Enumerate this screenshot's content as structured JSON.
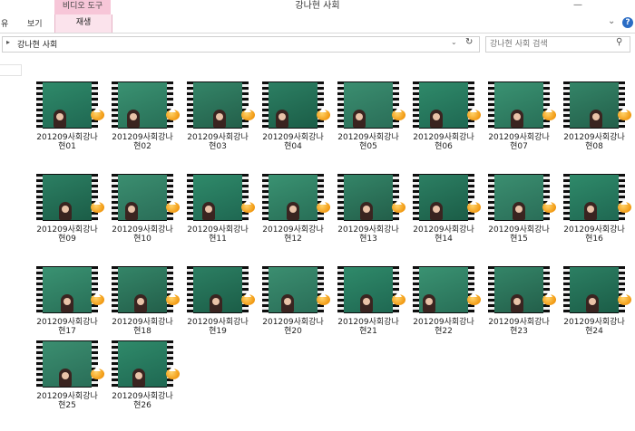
{
  "window": {
    "title": "강나현 사회",
    "contextual_tab_group": "비디오 도구",
    "minimize_glyph": "—"
  },
  "ribbon": {
    "tabs": [
      {
        "label": "유"
      },
      {
        "label": "보기"
      },
      {
        "label": "재생"
      }
    ],
    "expand_glyph": "⌄",
    "help_glyph": "?"
  },
  "address": {
    "breadcrumb": "강나현 사회",
    "search_placeholder": "강나현 사회 검색"
  },
  "files": [
    {
      "line1": "201209사회강나",
      "line2": "현01"
    },
    {
      "line1": "201209사회강나",
      "line2": "현02"
    },
    {
      "line1": "201209사회강나",
      "line2": "현03"
    },
    {
      "line1": "201209사회강나",
      "line2": "현04"
    },
    {
      "line1": "201209사회강나",
      "line2": "현05"
    },
    {
      "line1": "201209사회강나",
      "line2": "현06"
    },
    {
      "line1": "201209사회강나",
      "line2": "현07"
    },
    {
      "line1": "201209사회강나",
      "line2": "현08"
    },
    {
      "line1": "201209사회강나",
      "line2": "현09"
    },
    {
      "line1": "201209사회강나",
      "line2": "현10"
    },
    {
      "line1": "201209사회강나",
      "line2": "현11"
    },
    {
      "line1": "201209사회강나",
      "line2": "현12"
    },
    {
      "line1": "201209사회강나",
      "line2": "현13"
    },
    {
      "line1": "201209사회강나",
      "line2": "현14"
    },
    {
      "line1": "201209사회강나",
      "line2": "현15"
    },
    {
      "line1": "201209사회강나",
      "line2": "현16"
    },
    {
      "line1": "201209사회강나",
      "line2": "현17"
    },
    {
      "line1": "201209사회강나",
      "line2": "현18"
    },
    {
      "line1": "201209사회강나",
      "line2": "현19"
    },
    {
      "line1": "201209사회강나",
      "line2": "현20"
    },
    {
      "line1": "201209사회강나",
      "line2": "현21"
    },
    {
      "line1": "201209사회강나",
      "line2": "현22"
    },
    {
      "line1": "201209사회강나",
      "line2": "현23"
    },
    {
      "line1": "201209사회강나",
      "line2": "현24"
    },
    {
      "line1": "201209사회강나",
      "line2": "현25"
    },
    {
      "line1": "201209사회강나",
      "line2": "현26"
    }
  ],
  "icons": {
    "file_thumbnail": "video-film-strip-icon",
    "file_badge": "vlc-cone-icon",
    "search": "search-icon",
    "refresh": "refresh-icon",
    "address_dropdown": "chevron-down-icon",
    "address_arrow": "chevron-right-icon"
  }
}
